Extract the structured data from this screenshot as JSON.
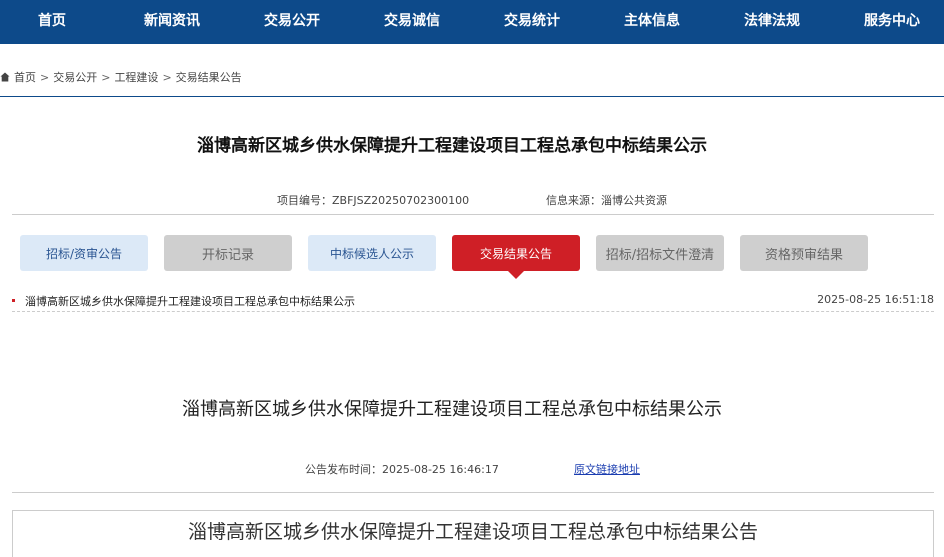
{
  "nav": {
    "items": [
      "首页",
      "新闻资讯",
      "交易公开",
      "交易诚信",
      "交易统计",
      "主体信息",
      "法律法规",
      "服务中心"
    ]
  },
  "breadcrumb": {
    "items": [
      "首页",
      "交易公开",
      "工程建设",
      "交易结果公告"
    ],
    "separator": ">"
  },
  "page": {
    "title": "淄博高新区城乡供水保障提升工程建设项目工程总承包中标结果公示",
    "project_no": "项目编号：ZBFJSZ20250702300100",
    "source": "信息来源：淄博公共资源"
  },
  "tabs": [
    {
      "label": "招标/资审公告",
      "state": "blue"
    },
    {
      "label": "开标记录",
      "state": "gray"
    },
    {
      "label": "中标候选人公示",
      "state": "blue"
    },
    {
      "label": "交易结果公告",
      "state": "active"
    },
    {
      "label": "招标/招标文件澄清",
      "state": "gray"
    },
    {
      "label": "资格预审结果",
      "state": "gray"
    }
  ],
  "result_list": [
    {
      "title": "淄博高新区城乡供水保障提升工程建设项目工程总承包中标结果公示",
      "date": "2025-08-25 16:51:18"
    }
  ],
  "article": {
    "title": "淄博高新区城乡供水保障提升工程建设项目工程总承包中标结果公示",
    "publish_time": "公告发布时间：2025-08-25 16:46:17",
    "original_link": "原文链接地址",
    "document_title": "淄博高新区城乡供水保障提升工程建设项目工程总承包中标结果公告"
  },
  "colors": {
    "nav_bg": "#0d4a8a",
    "active_tab": "#cf1f26",
    "blue_tab": "#dce9f7",
    "gray_tab": "#cfcfcf"
  }
}
